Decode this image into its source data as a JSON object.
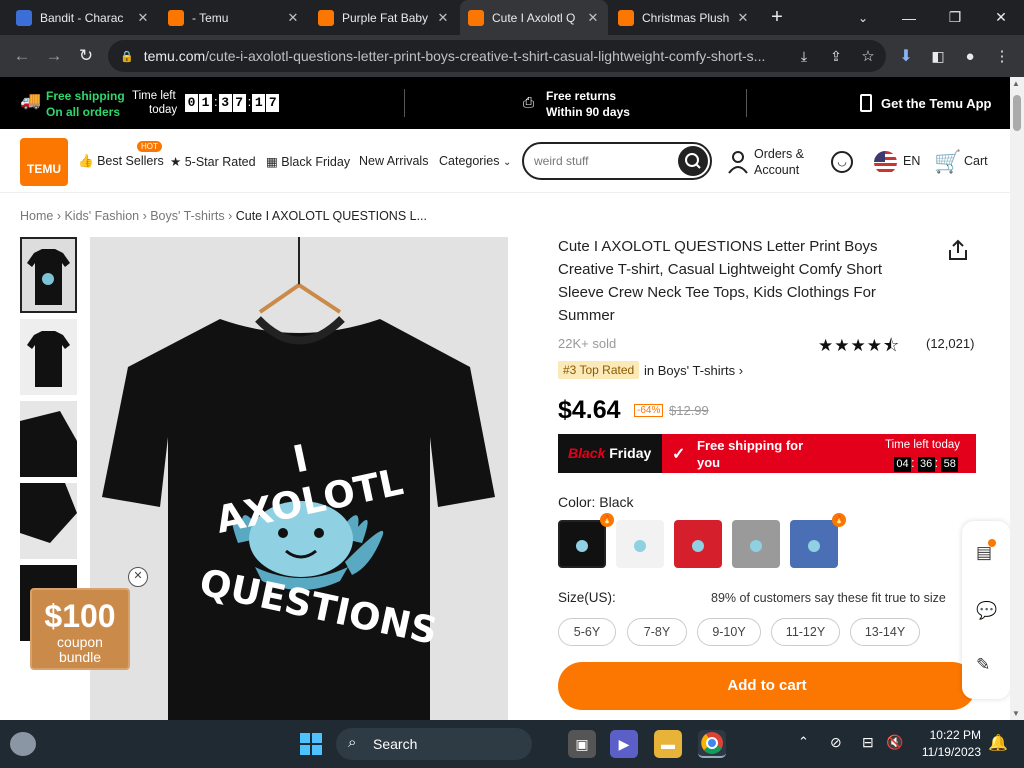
{
  "browser": {
    "tabs": [
      {
        "title": "Bandit - Charac",
        "active": false,
        "favicon": "bluey-favicon"
      },
      {
        "title": "- Temu",
        "active": false,
        "favicon": "temu-favicon"
      },
      {
        "title": "Purple Fat Baby",
        "active": false,
        "favicon": "temu-favicon"
      },
      {
        "title": "Cute I Axolotl Q",
        "active": true,
        "favicon": "temu-favicon"
      },
      {
        "title": "Christmas Plush",
        "active": false,
        "favicon": "temu-favicon"
      }
    ],
    "url_domain": "temu.com",
    "url_path": "/cute-i-axolotl-questions-letter-print-boys-creative-t-shirt-casual-lightweight-comfy-short-s..."
  },
  "promo": {
    "free_shipping": "Free shipping",
    "on_all_orders": "On all orders",
    "time_left": "Time left",
    "today": "today",
    "timer_digits": [
      "0",
      "1",
      "3",
      "7",
      "1",
      "7"
    ],
    "free_returns": "Free returns",
    "within_days": "Within 90 days",
    "get_app": "Get the Temu App"
  },
  "header": {
    "logo_text": "TEMU",
    "nav": [
      "Best Sellers",
      "5-Star Rated",
      "Black Friday",
      "New Arrivals",
      "Categories"
    ],
    "hot_badge": "HOT",
    "search_placeholder": "weird stuff",
    "orders_line1": "Orders &",
    "orders_line2": "Account",
    "language": "EN",
    "cart": "Cart"
  },
  "breadcrumb": [
    "Home",
    "Kids' Fashion",
    "Boys' T-shirts",
    "Cute I AXOLOTL QUESTIONS L..."
  ],
  "product": {
    "title": "Cute I AXOLOTL QUESTIONS Letter Print Boys Creative T-shirt, Casual Lightweight Comfy Short Sleeve Crew Neck Tee Tops, Kids Clothings For Summer",
    "sold": "22K+ sold",
    "rating_count": "(12,021)",
    "rating_stars": 4.5,
    "rank_badge": "#3 Top Rated",
    "rank_category": "in Boys' T-shirts",
    "price": "$4.64",
    "discount": "-64%",
    "original_price": "$12.99",
    "black": "Black",
    "friday": "Friday",
    "free_shipping_line1": "Free shipping for",
    "free_shipping_line2": "you",
    "time_left_today": "Time left today",
    "countdown": [
      "04",
      "36",
      "58"
    ],
    "color_label": "Color:",
    "color_value": "Black",
    "size_label": "Size(US):",
    "fit_note": "89% of customers say these fit true to size",
    "sizes": [
      "5-6Y",
      "7-8Y",
      "9-10Y",
      "11-12Y",
      "13-14Y"
    ],
    "add_to_cart": "Add to cart",
    "print_line1": "I AXOLOTL",
    "print_line2": "QUESTIONS"
  },
  "coupon": {
    "amount": "$100",
    "line1": "coupon",
    "line2": "bundle"
  },
  "taskbar": {
    "search": "Search",
    "time": "10:22 PM",
    "date": "11/19/2023"
  },
  "colors": {
    "accent": "#fb7701",
    "black_friday_red": "#e3001b",
    "free_shipping_green": "#2fd66b"
  }
}
